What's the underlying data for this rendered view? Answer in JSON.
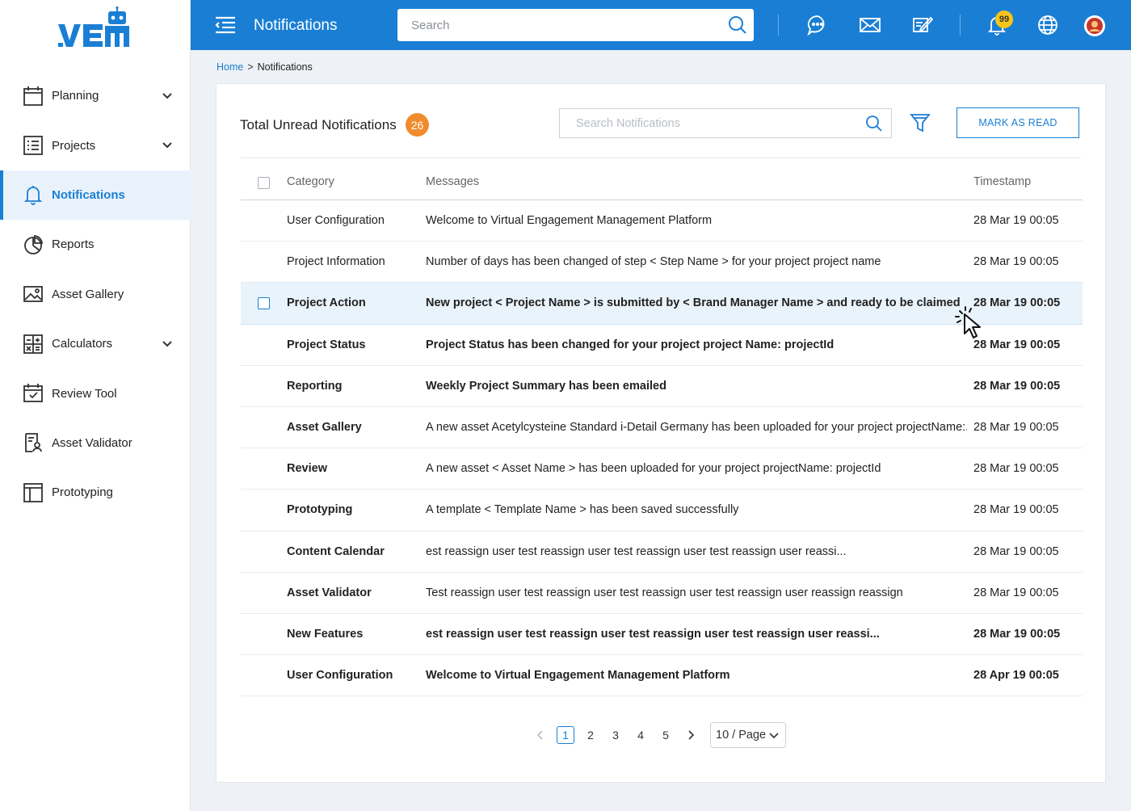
{
  "brand": {
    "logo_text": "VEM"
  },
  "sidebar": {
    "items": [
      {
        "label": "Planning",
        "icon": "calendar-icon",
        "has_chevron": true,
        "active": false
      },
      {
        "label": "Projects",
        "icon": "list-icon",
        "has_chevron": true,
        "active": false
      },
      {
        "label": "Notifications",
        "icon": "bell-icon",
        "has_chevron": false,
        "active": true
      },
      {
        "label": "Reports",
        "icon": "pie-chart-icon",
        "has_chevron": false,
        "active": false
      },
      {
        "label": "Asset Gallery",
        "icon": "image-icon",
        "has_chevron": false,
        "active": false
      },
      {
        "label": "Calculators",
        "icon": "calculator-icon",
        "has_chevron": true,
        "active": false
      },
      {
        "label": "Review Tool",
        "icon": "calendar-check-icon",
        "has_chevron": false,
        "active": false
      },
      {
        "label": "Asset Validator",
        "icon": "document-user-icon",
        "has_chevron": false,
        "active": false
      },
      {
        "label": "Prototyping",
        "icon": "layout-icon",
        "has_chevron": false,
        "active": false
      }
    ]
  },
  "header": {
    "title": "Notifications",
    "search_placeholder": "Search",
    "notification_count": "99",
    "accent_color": "#1a7fd4"
  },
  "breadcrumb": {
    "home": "Home",
    "separator": ">",
    "current": "Notifications"
  },
  "card": {
    "title": "Total Unread Notifications",
    "unread_count": "26",
    "search_placeholder": "Search Notifications",
    "mark_read_label": "MARK AS READ"
  },
  "table": {
    "headers": {
      "category": "Category",
      "messages": "Messages",
      "timestamp": "Timestamp"
    },
    "rows": [
      {
        "category": "User Configuration",
        "message": "Welcome to Virtual Engagement Management Platform",
        "timestamp": "28 Mar 19 00:05",
        "unread": false
      },
      {
        "category": "Project Information",
        "message": "Number of days has been changed of step < Step Name > for your project project name",
        "timestamp": "28 Mar 19 00:05",
        "unread": false
      },
      {
        "category": "Project Action",
        "message": "New project  < Project Name > is submitted by  < Brand Manager Name > and ready to be claimed",
        "timestamp": "28 Mar 19 00:05",
        "unread": true,
        "hovered": true
      },
      {
        "category": "Project Status",
        "message": "Project Status has been changed for your project project Name: projectId",
        "timestamp": "28 Mar 19 00:05",
        "unread": false
      },
      {
        "category": "Reporting",
        "message": "Weekly Project Summary has been emailed",
        "timestamp": "28 Mar 19 00:05",
        "unread": false
      },
      {
        "category": "Asset Gallery",
        "message": "A new asset Acetylcysteine Standard i-Detail Germany has been uploaded for your project projectName:...",
        "timestamp": "28 Mar 19 00:05",
        "unread": false
      },
      {
        "category": "Review",
        "message": "A new asset < Asset Name > has been uploaded for your project projectName: projectId",
        "timestamp": "28 Mar 19 00:05",
        "unread": false
      },
      {
        "category": "Prototyping",
        "message": "A template < Template Name > has been saved successfully",
        "timestamp": "28 Mar 19 00:05",
        "unread": false
      },
      {
        "category": "Content Calendar",
        "message": "est reassign user test reassign user test reassign user test reassign user reassi...",
        "timestamp": "28 Mar 19 00:05",
        "unread": false
      },
      {
        "category": "Asset Validator",
        "message": "Test reassign user test reassign user test reassign user test reassign user reassign reassign",
        "timestamp": "28 Mar 19 00:05",
        "unread": false
      },
      {
        "category": "New Features",
        "message": "est reassign user test reassign user test reassign user test reassign user reassi...",
        "timestamp": "28 Mar 19 00:05",
        "unread": true
      },
      {
        "category": "User Configuration",
        "message": "Welcome to Virtual Engagement Management Platform",
        "timestamp": "28 Apr 19 00:05",
        "unread": true
      }
    ]
  },
  "pagination": {
    "pages": [
      "1",
      "2",
      "3",
      "4",
      "5"
    ],
    "current_page": "1",
    "page_size": "10 / Page"
  }
}
